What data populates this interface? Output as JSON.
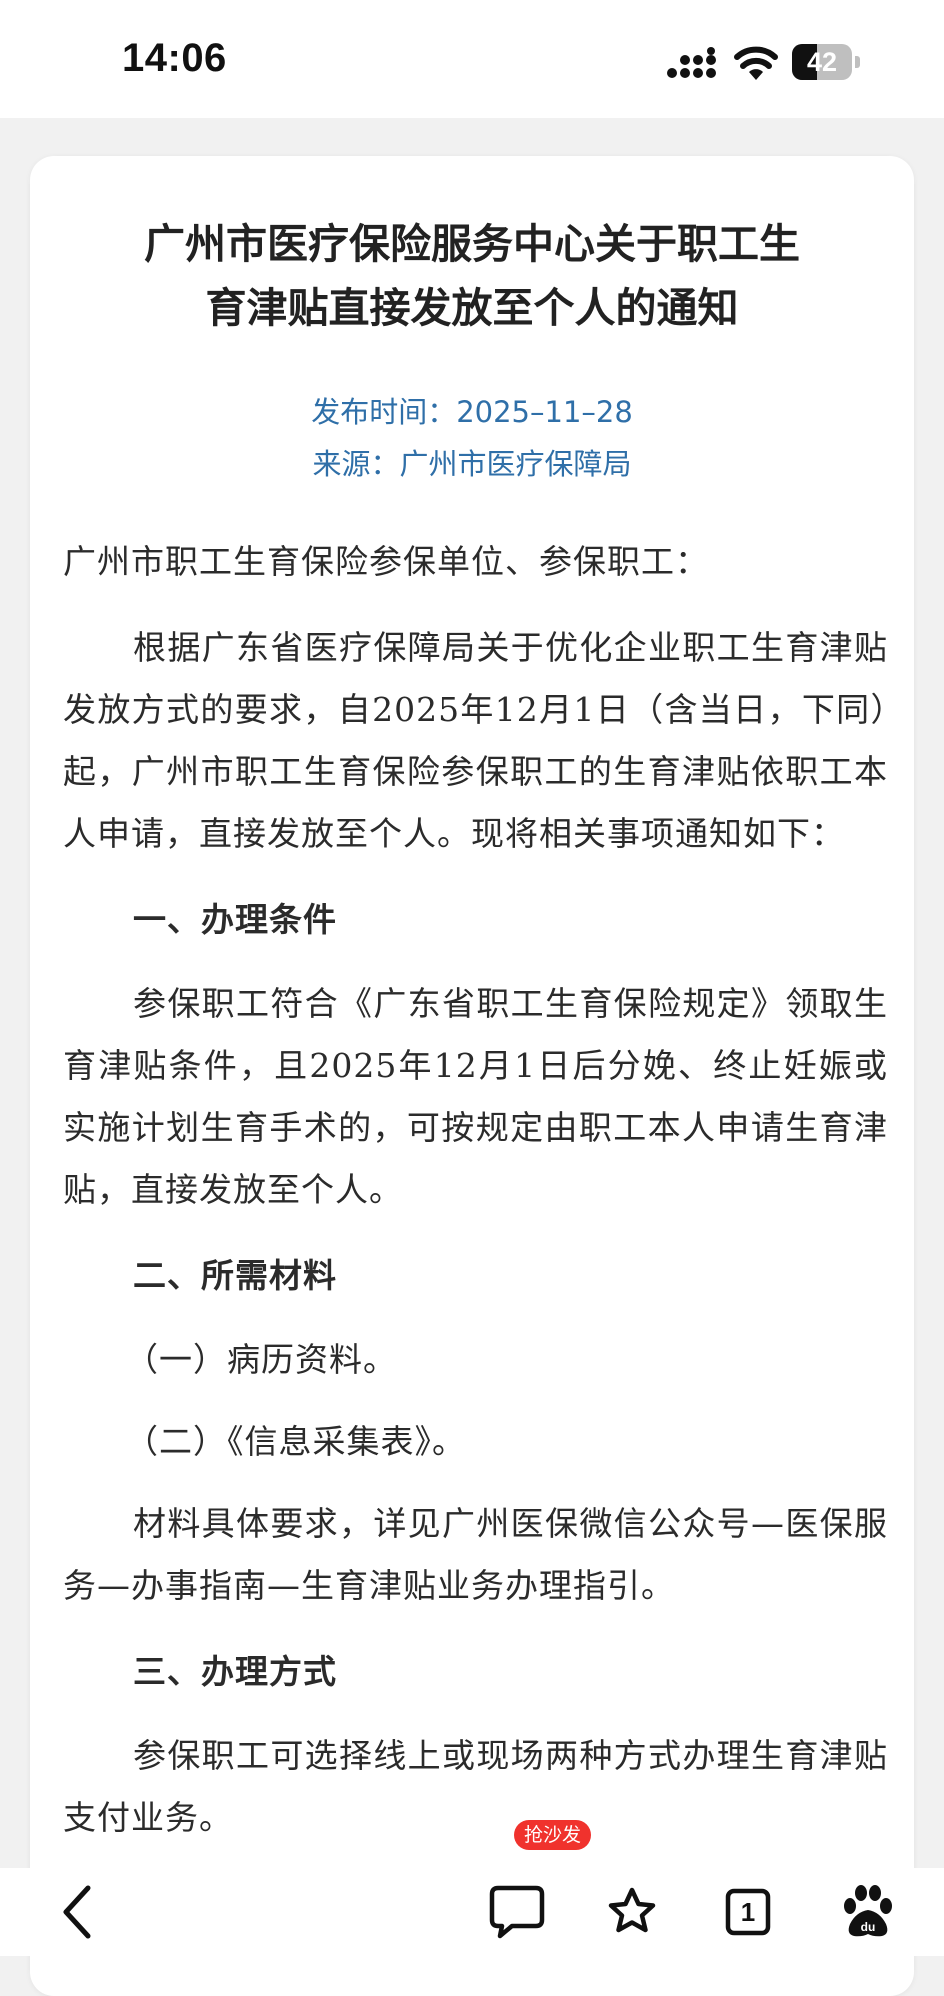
{
  "status_bar": {
    "time": "14:06",
    "battery_level": "42",
    "battery_fraction": 0.42
  },
  "article": {
    "title_line1": "广州市医疗保险服务中心关于职工生",
    "title_line2": "育津贴直接发放至个人的通知",
    "publish_time": "发布时间：2025–11–28",
    "source": "来源：广州市医疗保障局",
    "salutation": "广州市职工生育保险参保单位、参保职工：",
    "intro_a": "根据广东省医疗保障局关于优化企业职工生育津贴发放方式的要求，自",
    "intro_date": "2025年12月1日",
    "intro_b": "（含当日，下同）起，广州市职工生育保险参保职工的生育津贴依职工本人申请，直接发放至个人。现将相关事项通知如下：",
    "section1_heading": "一、办理条件",
    "section1_a": "参保职工符合《广东省职工生育保险规定》领取生育津贴条件，且",
    "section1_date": "2025年12月1日",
    "section1_b": "后分娩、终止妊娠或实施计划生育手术的，可按规定由职工本人申请生育津贴，直接发放至个人。",
    "section2_heading": "二、所需材料",
    "section2_item1": "（一）病历资料。",
    "section2_item2": "（二）《信息采集表》。",
    "section2_note": "材料具体要求，详见广州医保微信公众号—医保服务—办事指南—生育津贴业务办理指引。",
    "section3_heading": "三、办理方式",
    "section3_para": "参保职工可选择线上或现场两种方式办理生育津贴支付业务。"
  },
  "toolbar": {
    "comment_badge": "抢沙发",
    "tabs_count": "1"
  },
  "icons": {
    "back": "chevron-left-icon",
    "comment": "comment-bubble-icon",
    "favorite": "star-icon",
    "tabs": "tabs-icon",
    "baidu": "baidu-paw-icon"
  },
  "colors": {
    "meta_text": "#2f6fa8",
    "badge": "#f0322d",
    "page_bg": "#f1f1f1"
  }
}
